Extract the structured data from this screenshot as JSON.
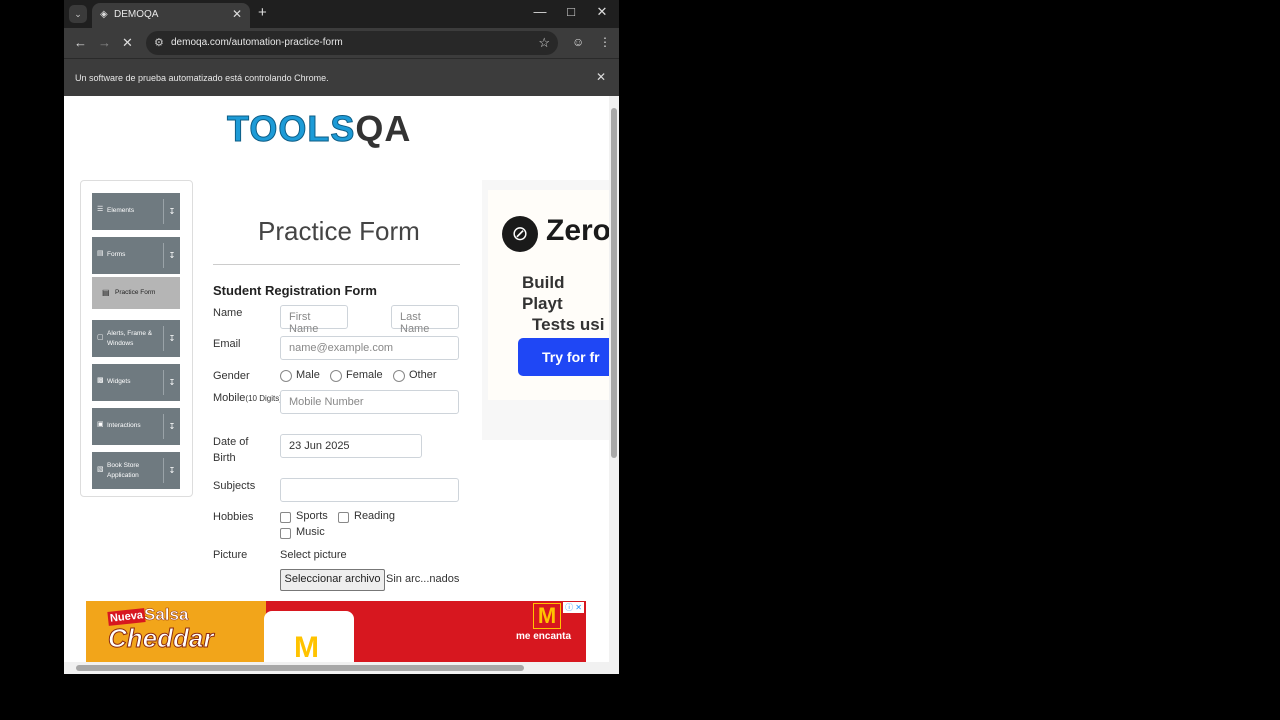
{
  "browser": {
    "tab_title": "DEMOQA",
    "url": "demoqa.com/automation-practice-form",
    "automation_notice": "Un software de prueba automatizado está controlando Chrome."
  },
  "logo": {
    "text_main": "TOOLS",
    "text_qa": "QA"
  },
  "sidebar": {
    "groups": [
      {
        "label": "Elements"
      },
      {
        "label": "Forms"
      },
      {
        "label": "Alerts, Frame & Windows"
      },
      {
        "label": "Widgets"
      },
      {
        "label": "Interactions"
      },
      {
        "label": "Book Store Application"
      }
    ],
    "active_item": "Practice Form"
  },
  "form": {
    "page_title": "Practice Form",
    "title": "Student Registration Form",
    "name_label": "Name",
    "first_name_placeholder": "First Name",
    "last_name_placeholder": "Last Name",
    "email_label": "Email",
    "email_placeholder": "name@example.com",
    "gender_label": "Gender",
    "gender_options": [
      "Male",
      "Female",
      "Other"
    ],
    "mobile_label": "Mobile",
    "mobile_hint": "(10 Digits)",
    "mobile_placeholder": "Mobile Number",
    "dob_label_1": "Date of",
    "dob_label_2": "Birth",
    "dob_value": "23 Jun 2025",
    "subjects_label": "Subjects",
    "hobbies_label": "Hobbies",
    "hobbies": [
      "Sports",
      "Reading",
      "Music"
    ],
    "picture_label": "Picture",
    "select_picture": "Select picture",
    "file_button": "Seleccionar archivo",
    "file_status": "Sin arc...nados"
  },
  "ad_right": {
    "brand": "Zero",
    "headline_1": "Build Playt",
    "headline_2": "Tests usi",
    "button": "Try for fr"
  },
  "ad_bottom": {
    "nueva": "Nueva",
    "salsa": "Salsa",
    "cheddar": "Cheddar",
    "slogan": "me encanta",
    "logo_letter": "M"
  }
}
